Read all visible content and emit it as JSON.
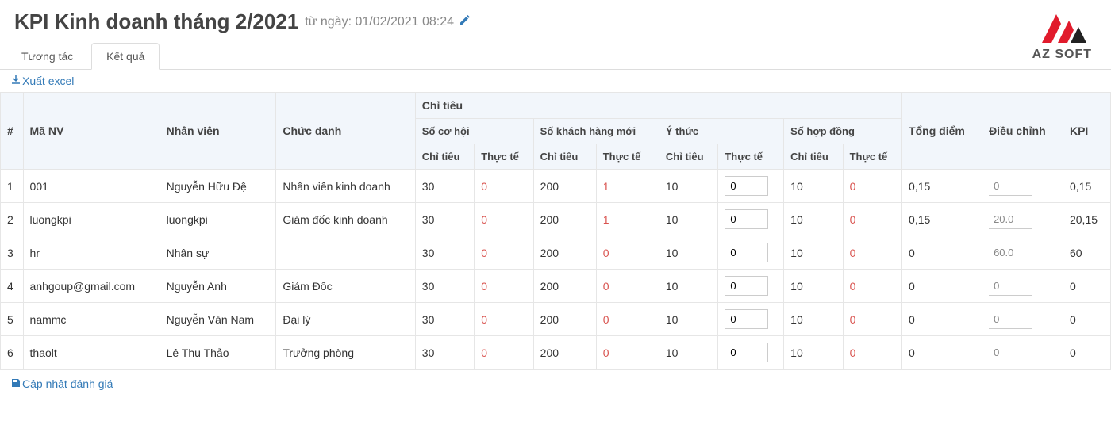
{
  "header": {
    "title": "KPI Kinh doanh tháng 2/2021",
    "subtitle": "từ ngày: 01/02/2021 08:24"
  },
  "logo": {
    "text": "AZ SOFT"
  },
  "tabs": {
    "items": [
      {
        "label": "Tương tác",
        "active": false
      },
      {
        "label": "Kết quả",
        "active": true
      }
    ]
  },
  "actions": {
    "export": "Xuất excel",
    "update": "Cập nhật đánh giá"
  },
  "table": {
    "head": {
      "idx": "#",
      "code": "Mã NV",
      "name": "Nhân viên",
      "role": "Chức danh",
      "chitieu": "Chỉ tiêu",
      "tongdiem": "Tổng điểm",
      "dieuchinh": "Điều chỉnh",
      "kpi": "KPI",
      "groups": [
        "Số cơ hội",
        "Số khách hàng mới",
        "Ý thức",
        "Số hợp đồng"
      ],
      "sub_chi": "Chỉ tiêu",
      "sub_thuc": "Thực tế"
    },
    "rows": [
      {
        "idx": "1",
        "code": "001",
        "name": "Nguyễn Hữu Đệ",
        "role": "Nhân viên kinh doanh",
        "g1c": "30",
        "g1t": "0",
        "g2c": "200",
        "g2t": "1",
        "g3c": "10",
        "g3t": "0",
        "g4c": "10",
        "g4t": "0",
        "tong": "0,15",
        "adj": "0",
        "kpi": "0,15"
      },
      {
        "idx": "2",
        "code": "luongkpi",
        "name": "luongkpi",
        "role": "Giám đốc kinh doanh",
        "g1c": "30",
        "g1t": "0",
        "g2c": "200",
        "g2t": "1",
        "g3c": "10",
        "g3t": "0",
        "g4c": "10",
        "g4t": "0",
        "tong": "0,15",
        "adj": "20.0",
        "kpi": "20,15"
      },
      {
        "idx": "3",
        "code": "hr",
        "name": "Nhân sự",
        "role": "",
        "g1c": "30",
        "g1t": "0",
        "g2c": "200",
        "g2t": "0",
        "g3c": "10",
        "g3t": "0",
        "g4c": "10",
        "g4t": "0",
        "tong": "0",
        "adj": "60.0",
        "kpi": "60"
      },
      {
        "idx": "4",
        "code": "anhgoup@gmail.com",
        "name": "Nguyễn Anh",
        "role": "Giám Đốc",
        "g1c": "30",
        "g1t": "0",
        "g2c": "200",
        "g2t": "0",
        "g3c": "10",
        "g3t": "0",
        "g4c": "10",
        "g4t": "0",
        "tong": "0",
        "adj": "0",
        "kpi": "0"
      },
      {
        "idx": "5",
        "code": "nammc",
        "name": "Nguyễn Văn Nam",
        "role": "Đại lý",
        "g1c": "30",
        "g1t": "0",
        "g2c": "200",
        "g2t": "0",
        "g3c": "10",
        "g3t": "0",
        "g4c": "10",
        "g4t": "0",
        "tong": "0",
        "adj": "0",
        "kpi": "0"
      },
      {
        "idx": "6",
        "code": "thaolt",
        "name": "Lê Thu Thảo",
        "role": "Trưởng phòng",
        "g1c": "30",
        "g1t": "0",
        "g2c": "200",
        "g2t": "0",
        "g3c": "10",
        "g3t": "0",
        "g4c": "10",
        "g4t": "0",
        "tong": "0",
        "adj": "0",
        "kpi": "0"
      }
    ]
  }
}
